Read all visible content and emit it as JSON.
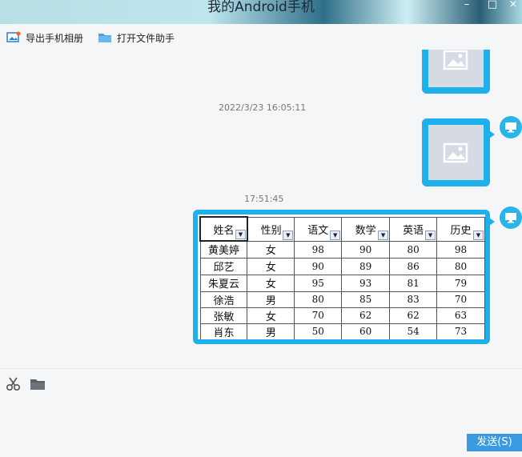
{
  "window": {
    "title": "我的Android手机",
    "min": "–",
    "max": "□",
    "close": "×"
  },
  "toolbar": {
    "export_label": "导出手机相册",
    "open_label": "打开文件助手"
  },
  "messages": {
    "timestamp_1": "2022/3/23 16:05:11",
    "timestamp_2": "17:51:45"
  },
  "sheet": {
    "headers": [
      "姓名",
      "性别",
      "语文",
      "数学",
      "英语",
      "历史"
    ],
    "rows": [
      [
        "黄美婷",
        "女",
        "98",
        "90",
        "80",
        "98"
      ],
      [
        "邱艺",
        "女",
        "90",
        "89",
        "86",
        "80"
      ],
      [
        "朱夏云",
        "女",
        "95",
        "93",
        "81",
        "79"
      ],
      [
        "徐浩",
        "男",
        "80",
        "85",
        "83",
        "70"
      ],
      [
        "张敏",
        "女",
        "70",
        "62",
        "62",
        "63"
      ],
      [
        "肖东",
        "男",
        "50",
        "60",
        "54",
        "73"
      ]
    ]
  },
  "input": {
    "send_label": "发送(S)"
  },
  "colors": {
    "accent": "#1eb0ea",
    "send": "#3c9be0"
  },
  "icons": [
    "export-photos-icon",
    "folder-icon",
    "image-placeholder-icon",
    "monitor-icon",
    "scissors-icon",
    "folder-icon"
  ]
}
